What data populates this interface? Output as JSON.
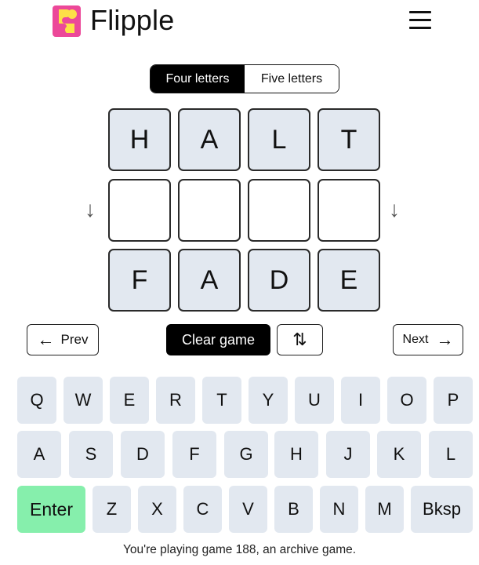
{
  "app": {
    "title": "Flipple"
  },
  "colors": {
    "tile_fill": "#e2e8f0",
    "key_fill": "#e2e8f0",
    "enter_fill": "#86efac",
    "logo_pink": "#ec4899",
    "logo_yellow": "#fde047",
    "toggle_active": "#000000"
  },
  "mode": {
    "four_letters": "Four letters",
    "five_letters": "Five letters",
    "active": "four_letters"
  },
  "board": {
    "rows": [
      [
        "H",
        "A",
        "L",
        "T"
      ],
      [
        "",
        "",
        "",
        ""
      ],
      [
        "F",
        "A",
        "D",
        "E"
      ]
    ],
    "arrow_left": "↓",
    "arrow_right": "↓"
  },
  "controls": {
    "prev_icon": "←",
    "prev_label": "Prev",
    "clear_label": "Clear game",
    "swap_icon": "⇅",
    "next_label": "Next",
    "next_icon": "→"
  },
  "keyboard": {
    "row1": [
      "Q",
      "W",
      "E",
      "R",
      "T",
      "Y",
      "U",
      "I",
      "O",
      "P"
    ],
    "row2": [
      "A",
      "S",
      "D",
      "F",
      "G",
      "H",
      "J",
      "K",
      "L"
    ],
    "row3": [
      "Enter",
      "Z",
      "X",
      "C",
      "V",
      "B",
      "N",
      "M",
      "Bksp"
    ]
  },
  "status": "You're playing game 188, an archive game."
}
